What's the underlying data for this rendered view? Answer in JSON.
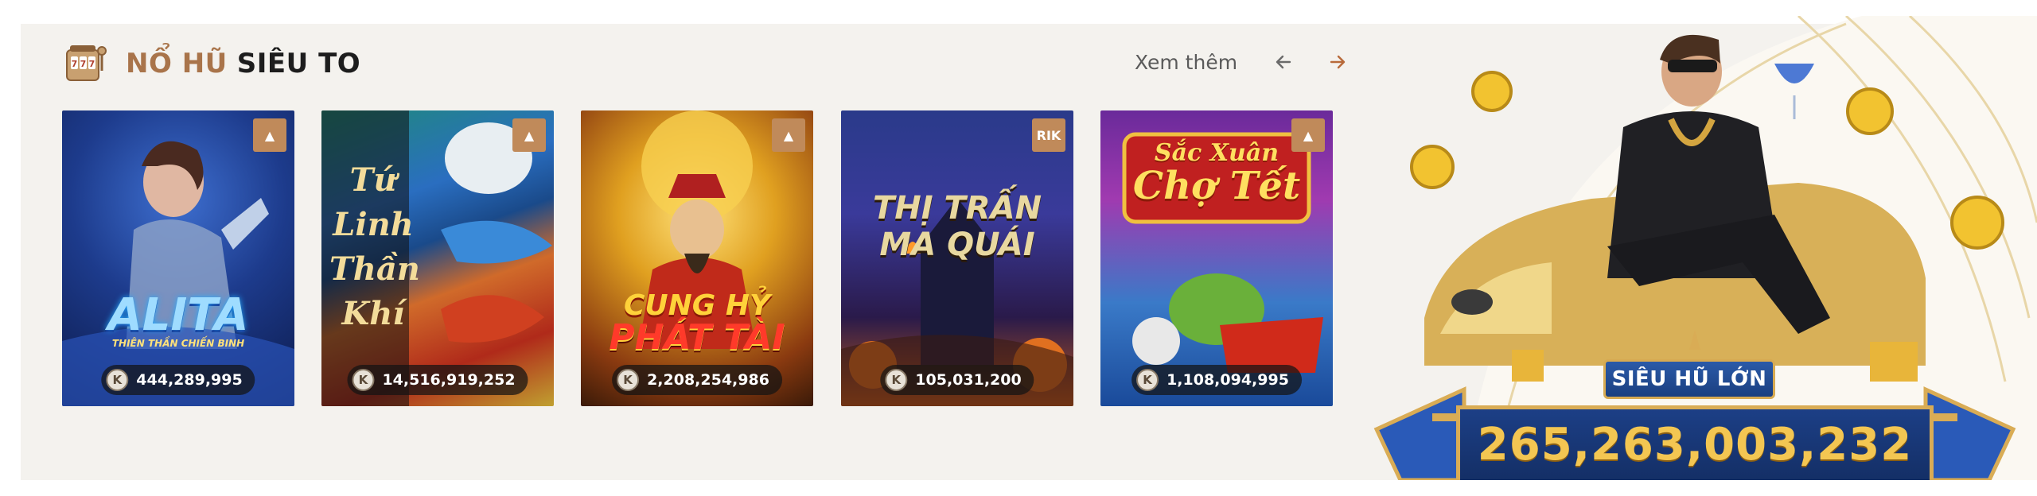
{
  "section": {
    "title_accent": "NỔ HŨ",
    "title_main": "SIÊU TO",
    "see_more_label": "Xem thêm",
    "icon": "slot-machine-icon",
    "accent_color": "#a9744a"
  },
  "games": [
    {
      "title_line1": "ALITA",
      "title_line2": "THIÊN THẦN CHIẾN BINH",
      "jackpot": "444,289,995",
      "provider_badge": "provider-logo-icon"
    },
    {
      "title_line1": "Tứ Linh",
      "title_line2": "Thần Khí",
      "jackpot": "14,516,919,252",
      "provider_badge": "provider-logo-icon"
    },
    {
      "title_line1": "CUNG HỶ",
      "title_line2": "PHÁT TÀI",
      "jackpot": "2,208,254,986",
      "provider_badge": "provider-logo-icon"
    },
    {
      "title_line1": "THỊ TRẤN",
      "title_line2": "MA QUÁI",
      "jackpot": "105,031,200",
      "provider_badge": "RIK"
    },
    {
      "title_line1": "Sắc Xuân",
      "title_line2": "Chợ Tết",
      "jackpot": "1,108,094,995",
      "provider_badge": "provider-logo-icon"
    }
  ],
  "coin_symbol": "K",
  "jackpot_banner": {
    "label": "SIÊU HŨ LỚN",
    "value": "265,263,003,232"
  }
}
